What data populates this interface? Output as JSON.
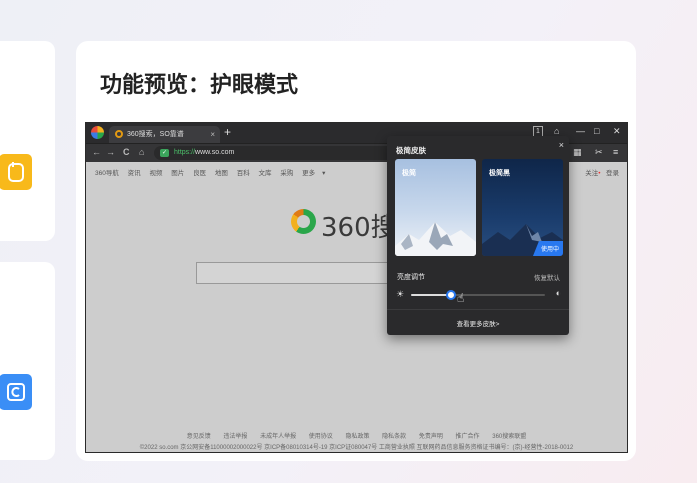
{
  "card": {
    "title": "功能预览：护眼模式"
  },
  "browser": {
    "tab_title": "360搜索，SO靠谱",
    "tab_close": "×",
    "new_tab": "+",
    "window_controls": {
      "badge": "1",
      "skin": "⌂",
      "minimize": "—",
      "maximize": "□",
      "close": "✕"
    },
    "nav": {
      "back": "←",
      "forward": "→",
      "reload": "C",
      "home": "⌂"
    },
    "url": {
      "scheme": "https://",
      "host": "www.so.com"
    },
    "tools": {
      "grid": "▦",
      "cut": "✂",
      "menu": "≡"
    }
  },
  "page": {
    "nav_links": [
      "360导航",
      "资讯",
      "视频",
      "图片",
      "良医",
      "地图",
      "百科",
      "文库",
      "采购",
      "更多"
    ],
    "more_caret": "▾",
    "right_links": {
      "follow": "关注",
      "dot": "•",
      "login": "登录"
    },
    "brand_text": "360搜",
    "footer_links": [
      "意见反馈",
      "违法举报",
      "未成年人举报",
      "使用协议",
      "隐私政策",
      "隐私条款",
      "免责声明",
      "推广合作",
      "360搜索联盟"
    ],
    "footer_copy": "©2022 so.com  京公网安备11000002000022号  京ICP备08010314号-19  京ICP证080047号  工商营业执照  互联网药品信息服务资格证书编号：(京)-经营性-2018-0012"
  },
  "skin_panel": {
    "title": "极简皮肤",
    "close": "×",
    "skins": [
      {
        "label": "极简",
        "active": false
      },
      {
        "label": "极简黑",
        "active": true,
        "badge": "使用中"
      }
    ],
    "brightness_label": "亮度调节",
    "restore_default": "恢复默认",
    "brightness_value": 0.3,
    "sun_icon": "☀",
    "contrast_icon": "◐",
    "more_skins": "查看更多皮肤>"
  },
  "colors": {
    "accent": "#2878f0",
    "panel_bg": "#2a2a2c",
    "yellow_app": "#f8b91a",
    "blue_app": "#3a8ef6"
  }
}
